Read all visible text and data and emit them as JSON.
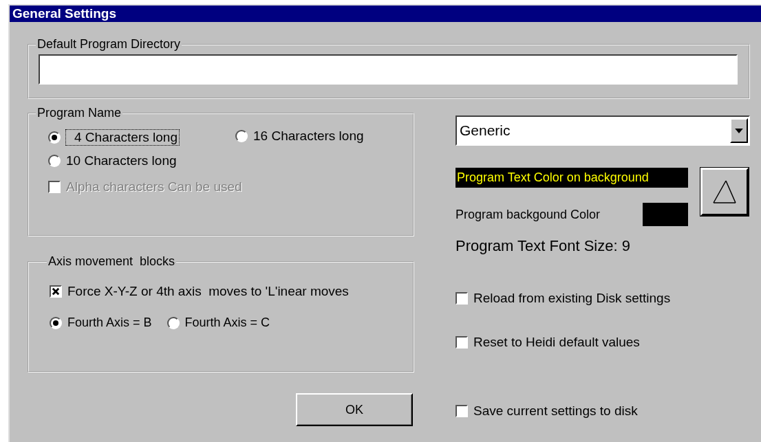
{
  "window": {
    "title": "General Settings"
  },
  "directory_group": {
    "label": "Default Program Directory"
  },
  "program_name_group": {
    "label": "Program Name",
    "options": [
      {
        "label": "4 Characters long",
        "selected": true,
        "focused": true
      },
      {
        "label": "16 Characters long",
        "selected": false,
        "focused": false
      },
      {
        "label": "10 Characters long",
        "selected": false,
        "focused": false
      }
    ],
    "alpha": {
      "label": "Alpha characters Can be used",
      "checked": false,
      "disabled": true
    }
  },
  "axis_group": {
    "label": "Axis movement  blocks",
    "force_linear": {
      "label": "Force X-Y-Z or 4th axis  moves to 'L'inear moves",
      "checked": true
    },
    "fourth_axis": [
      {
        "label": "Fourth Axis = B",
        "selected": true
      },
      {
        "label": "Fourth Axis = C",
        "selected": false
      }
    ]
  },
  "ok_button": "OK",
  "machine_dropdown": {
    "value": "Generic"
  },
  "text_color_sample": "Program Text Color on background",
  "background_color_label": "Program backgound Color",
  "font_size_label": "Program Text Font Size: 9",
  "options": [
    {
      "label": "Reload from existing Disk settings",
      "checked": false
    },
    {
      "label": "Reset to Heidi default values",
      "checked": false
    },
    {
      "label": "Save current settings to disk",
      "checked": false
    }
  ]
}
